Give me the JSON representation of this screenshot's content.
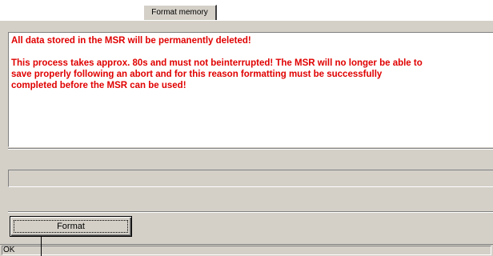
{
  "tab": {
    "label": "Format memory"
  },
  "message": {
    "line1": "All data stored in the MSR will be permanently deleted!",
    "line2": "This process takes approx. 80s and must not beinterrupted! The MSR will no longer be able to",
    "line3": "save properly following an abort and for this reason formatting must be successfully",
    "line4": "completed before the MSR can be used!",
    "color": "#e00000"
  },
  "progress": {
    "value": 0
  },
  "button": {
    "format_label": "Format"
  },
  "statusbar": {
    "text": "OK"
  }
}
